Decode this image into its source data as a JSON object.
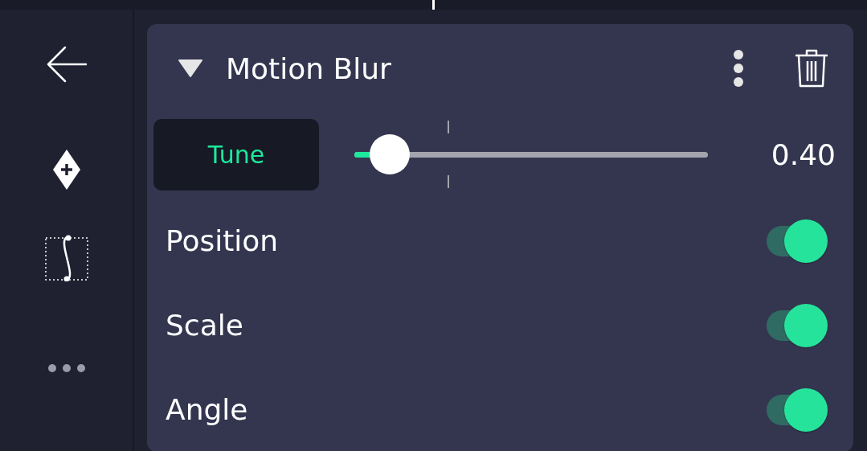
{
  "effect": {
    "title": "Motion Blur",
    "expanded": true
  },
  "tune": {
    "label": "Tune",
    "level": 0.1,
    "reading": "0.40"
  },
  "options": [
    {
      "label": "Position",
      "on": true
    },
    {
      "label": "Scale",
      "on": true
    },
    {
      "label": "Angle",
      "on": true
    }
  ]
}
